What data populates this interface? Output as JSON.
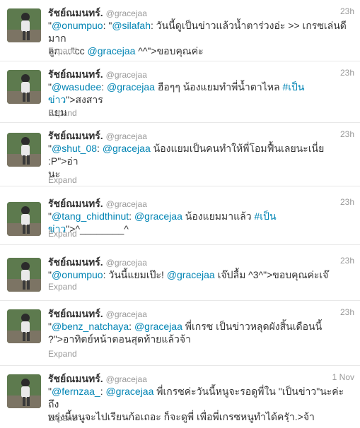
{
  "profile": {
    "fullname": "รัชย์ณมนทร์.",
    "username": "@gracejaa"
  },
  "expand_label": "Expand",
  "tweets": [
    {
      "time": "23h",
      "line1": [
        {
          "t": "\"",
          "c": "text"
        },
        {
          "t": "@onumpuo",
          "c": "link"
        },
        {
          "t": ": \"",
          "c": "text"
        },
        {
          "t": "@silafah",
          "c": "link"
        },
        {
          "t": ": วันนี้ดูเป็นข่าวแล้วน้ำตาร่วงอ่ะ >> เกรซเล่นดีมาก",
          "c": "text"
        }
      ],
      "line2": [
        {
          "t": "ลูก....\"cc ",
          "c": "text"
        },
        {
          "t": "@gracejaa",
          "c": "link"
        },
        {
          "t": " ^^\">ขอบคุณค่ะ",
          "c": "text"
        }
      ]
    },
    {
      "time": "23h",
      "line1": [
        {
          "t": "\"",
          "c": "text"
        },
        {
          "t": "@wasudee",
          "c": "link"
        },
        {
          "t": ": ",
          "c": "text"
        },
        {
          "t": "@gracejaa",
          "c": "link"
        },
        {
          "t": " ฮือๆๆ น้องแยมทำพี่น้ำตาไหล ",
          "c": "text"
        },
        {
          "t": "#เป็นข่าว",
          "c": "link"
        },
        {
          "t": "\">สงสาร",
          "c": "text"
        }
      ],
      "line2": [
        {
          "t": "แยม",
          "c": "text"
        }
      ]
    },
    {
      "time": "23h",
      "line1": [
        {
          "t": "\"",
          "c": "text"
        },
        {
          "t": "@shut_08",
          "c": "link"
        },
        {
          "t": ": ",
          "c": "text"
        },
        {
          "t": "@gracejaa",
          "c": "link"
        },
        {
          "t": " น้องแยมเป็นคนทำให้พี่โอมฟื้นเลยนะเนี่ย :P\">อ่า",
          "c": "text"
        }
      ],
      "line2": [
        {
          "t": "นะ",
          "c": "text"
        }
      ]
    },
    {
      "time": "23h",
      "line1": [
        {
          "t": "\"",
          "c": "text"
        },
        {
          "t": "@tang_chidthinut",
          "c": "link"
        },
        {
          "t": ": ",
          "c": "text"
        },
        {
          "t": "@gracejaa",
          "c": "link"
        },
        {
          "t": " น้องแยมมาแล้ว ",
          "c": "text"
        },
        {
          "t": "#เป็นข่าว",
          "c": "link"
        },
        {
          "t": "\">^________^",
          "c": "text"
        }
      ],
      "line2": []
    },
    {
      "time": "23h",
      "line1": [
        {
          "t": "\"",
          "c": "text"
        },
        {
          "t": "@onumpuo",
          "c": "link"
        },
        {
          "t": ": วันนี้แยมเป๊ะ! ",
          "c": "text"
        },
        {
          "t": "@gracejaa",
          "c": "link"
        },
        {
          "t": " เจ๊ปลื้ม ^3^\">ขอบคุณค่ะเจ๊",
          "c": "text"
        }
      ],
      "line2": []
    },
    {
      "time": "23h",
      "line1": [
        {
          "t": "\"",
          "c": "text"
        },
        {
          "t": "@benz_natchaya",
          "c": "link"
        },
        {
          "t": ": ",
          "c": "text"
        },
        {
          "t": "@gracejaa",
          "c": "link"
        },
        {
          "t": " พี่เกรซ เป็นข่าวหลุดผังสิ้นเดือนนี้",
          "c": "text"
        }
      ],
      "line2": [
        {
          "t": "?\">อาทิตย์หน้าตอนสุดท้ายแล้วจ้า",
          "c": "text"
        }
      ]
    },
    {
      "time": "1 Nov",
      "line1": [
        {
          "t": "\"",
          "c": "text"
        },
        {
          "t": "@fernzaa_",
          "c": "link"
        },
        {
          "t": ": ",
          "c": "text"
        },
        {
          "t": "@gracejaa",
          "c": "link"
        },
        {
          "t": " พี่เกรซค่ะวันนี้หนูจะรอดูพี่ใน \"เป็นข่าว\"นะค่ะ ถึง",
          "c": "text"
        }
      ],
      "line2": [
        {
          "t": "พรุ่งนี้หนูจะไปเรียนก้อเถอะ ก็จะดูพี่ เพื่อพี่เกรซหนูทำได้ครัฺา.>จ้า",
          "c": "text"
        }
      ]
    }
  ]
}
